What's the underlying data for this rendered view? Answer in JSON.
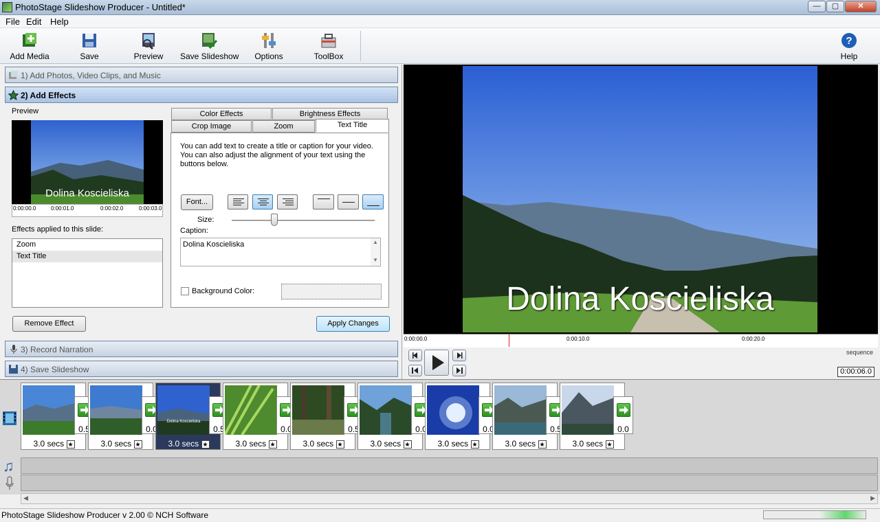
{
  "window": {
    "title": "PhotoStage Slideshow Producer - Untitled*",
    "minimize": "—",
    "maximize": "▢",
    "close": "✕"
  },
  "menu": [
    "File",
    "Edit",
    "Help"
  ],
  "toolbar": [
    {
      "label": "Add Media",
      "icon": "add-media-icon"
    },
    {
      "label": "Save",
      "icon": "save-icon"
    },
    {
      "label": "Preview",
      "icon": "preview-icon"
    },
    {
      "label": "Save Slideshow",
      "icon": "save-slideshow-icon"
    },
    {
      "label": "Options",
      "icon": "options-icon"
    },
    {
      "label": "ToolBox",
      "icon": "toolbox-icon"
    }
  ],
  "help_label": "Help",
  "steps": [
    {
      "label": "1)  Add Photos, Video Clips, and Music"
    },
    {
      "label": "2)  Add Effects"
    },
    {
      "label": "3)  Record Narration"
    },
    {
      "label": "4)  Save Slideshow"
    }
  ],
  "effects": {
    "preview_label": "Preview",
    "thumb_caption": "Dolina Koscieliska",
    "thumb_times": [
      "0:00:00.0",
      "0:00:01.0",
      "0:00:02.0",
      "0:00:03.0"
    ],
    "applied_label": "Effects applied to this slide:",
    "applied": [
      "Zoom",
      "Text Title"
    ],
    "remove_label": "Remove Effect",
    "apply_label": "Apply Changes",
    "tabs_top": [
      "Color Effects",
      "Brightness Effects"
    ],
    "tabs_bottom": [
      "Crop Image",
      "Zoom",
      "Text Title"
    ],
    "description": "You can add text to create a title or caption for your video. You can also adjust the alignment of your text using the buttons below.",
    "font_label": "Font...",
    "size_label": "Size:",
    "size_value": 0.3,
    "caption_label": "Caption:",
    "caption_value": "Dolina Koscieliska",
    "bg_color_label": "Background Color:"
  },
  "viewer": {
    "caption": "Dolina Koscieliska",
    "ticks": [
      "0:00:00.0",
      "0:00:10.0",
      "0:00:20.0"
    ],
    "sequence_label": "sequence",
    "time": "0:00:06.0"
  },
  "slides": [
    {
      "duration": "3.0 secs",
      "transition": "0.5"
    },
    {
      "duration": "3.0 secs",
      "transition": "0.0"
    },
    {
      "duration": "3.0 secs",
      "transition": "0.5",
      "caption": "Dolina Koscieliska"
    },
    {
      "duration": "3.0 secs",
      "transition": "0.0"
    },
    {
      "duration": "3.0 secs",
      "transition": "0.5"
    },
    {
      "duration": "3.0 secs",
      "transition": "0.0"
    },
    {
      "duration": "3.0 secs",
      "transition": "0.0"
    },
    {
      "duration": "3.0 secs",
      "transition": "0.5"
    },
    {
      "duration": "3.0 secs",
      "transition": "0.0"
    }
  ],
  "star": "★",
  "status": {
    "text": "PhotoStage Slideshow Producer v 2.00 © NCH Software"
  }
}
